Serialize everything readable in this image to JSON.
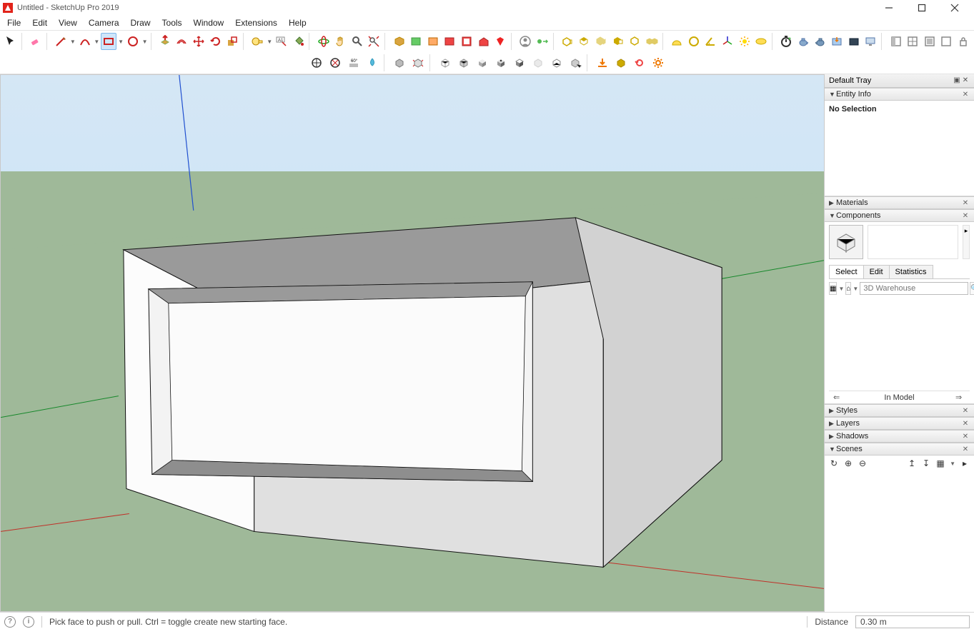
{
  "window": {
    "title": "Untitled - SketchUp Pro 2019"
  },
  "menu": [
    "File",
    "Edit",
    "View",
    "Camera",
    "Draw",
    "Tools",
    "Window",
    "Extensions",
    "Help"
  ],
  "tray": {
    "title": "Default Tray",
    "entity_info": {
      "label": "Entity Info",
      "status": "No Selection"
    },
    "materials": {
      "label": "Materials"
    },
    "components": {
      "label": "Components",
      "tabs": [
        "Select",
        "Edit",
        "Statistics"
      ],
      "search_placeholder": "3D Warehouse",
      "nav_label": "In Model"
    },
    "styles": {
      "label": "Styles"
    },
    "layers": {
      "label": "Layers"
    },
    "shadows": {
      "label": "Shadows"
    },
    "scenes": {
      "label": "Scenes"
    }
  },
  "status": {
    "hint": "Pick face to push or pull.  Ctrl = toggle create new starting face.",
    "measurement_label": "Distance",
    "measurement_value": "0.30 m"
  },
  "toolbar_row1": [
    "select",
    "eraser",
    "line",
    "line-dd",
    "freehand",
    "freehand-dd",
    "rectangle",
    "rectangle-dd",
    "circle",
    "circle-dd",
    "arc",
    "arc-dd",
    "pushpull",
    "offset",
    "move",
    "rotate",
    "scale",
    "followme",
    "tape",
    "tape-dd",
    "dimension",
    "text",
    "3dtext",
    "axes",
    "section",
    "paint",
    "orbit",
    "pan",
    "zoom",
    "zoom-extents",
    "zoom-window",
    "previous",
    "position-camera",
    "look-around",
    "walk",
    "addlocation",
    "togglelayer",
    "photomatch",
    "warehouse",
    "ext-warehouse",
    "ext-manager",
    "",
    "signout",
    "",
    "solid-outer",
    "solid-inner",
    "solid-intersect",
    "solid-union",
    "solid-subtract",
    "solid-trim",
    "solid-split",
    "",
    "protractor",
    "circle-guide",
    "angular-dim",
    "sun",
    "tangent",
    "ellipse",
    "",
    "chronometer",
    "teapot",
    "teapot2",
    "export-img",
    "render",
    "monitor",
    "",
    "window-a",
    "window-b",
    "window-c",
    "window-d",
    "lock"
  ],
  "toolbar_row2": [
    "sandbox-contours",
    "sandbox-scratch",
    "smoove",
    "stamp",
    "drape",
    "",
    "outer-shell",
    "explode",
    "",
    "soften",
    "hidden-geo",
    "xray",
    "wireframe",
    "shaded",
    "shaded-tex",
    "mono",
    "",
    "sel-all",
    "",
    "import",
    "component",
    "style-red",
    "settings"
  ]
}
